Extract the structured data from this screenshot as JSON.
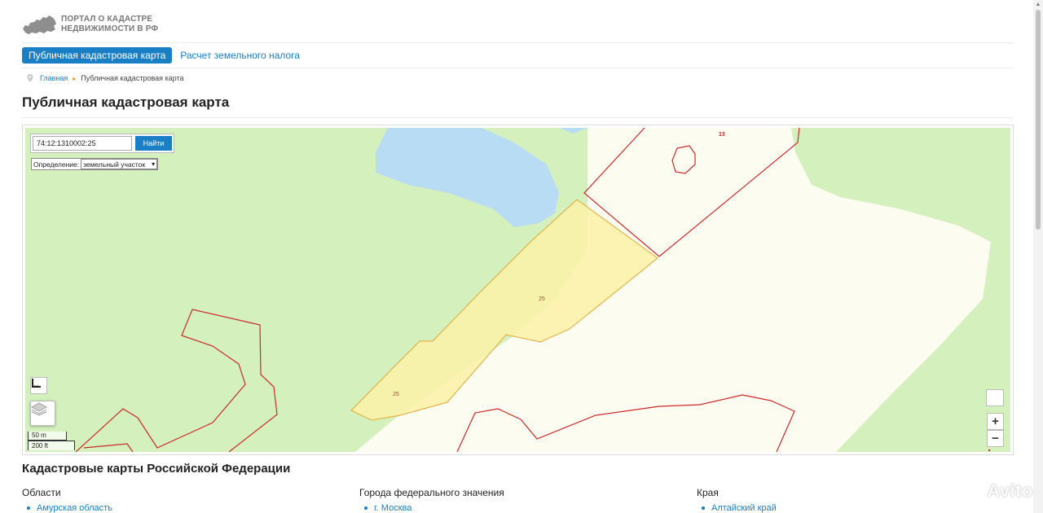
{
  "header": {
    "logo_line1": "ПОРТАЛ О КАДАСТРЕ",
    "logo_line2": "НЕДВИЖИМОСТИ В РФ"
  },
  "nav": {
    "active": "Публичная кадастровая карта",
    "link": "Расчет земельного налога"
  },
  "breadcrumb": {
    "home": "Главная",
    "current": "Публичная кадастровая карта"
  },
  "page_title": "Публичная кадастровая карта",
  "map": {
    "search_value": "74:12:1310002:25",
    "search_button": "Найти",
    "definition_label": "Определение:",
    "definition_selected": "земельный участок",
    "parcel_label_1": "25",
    "parcel_label_2": "25",
    "parcel_label_13": "13",
    "scale_m": "50 m",
    "scale_ft": "200 ft",
    "zoom_in": "+",
    "zoom_out": "−",
    "colors": {
      "forest": "#d3f0bd",
      "water": "#b8dcf4",
      "field": "#fdfcf1",
      "parcel_fill": "#fbf1a8",
      "parcel_stroke": "#e3a936",
      "boundary": "#cc2a2a"
    }
  },
  "section_title": "Кадастровые карты Российской Федерации",
  "columns": [
    {
      "heading": "Области",
      "first_item": "Амурская область"
    },
    {
      "heading": "Города федерального значения",
      "first_item": "г. Москва"
    },
    {
      "heading": "Края",
      "first_item": "Алтайский край"
    }
  ],
  "watermark": "Avito",
  "theme": {
    "accent": "#1a7fc4",
    "breadcrumb_sep": "#f08a1c"
  }
}
